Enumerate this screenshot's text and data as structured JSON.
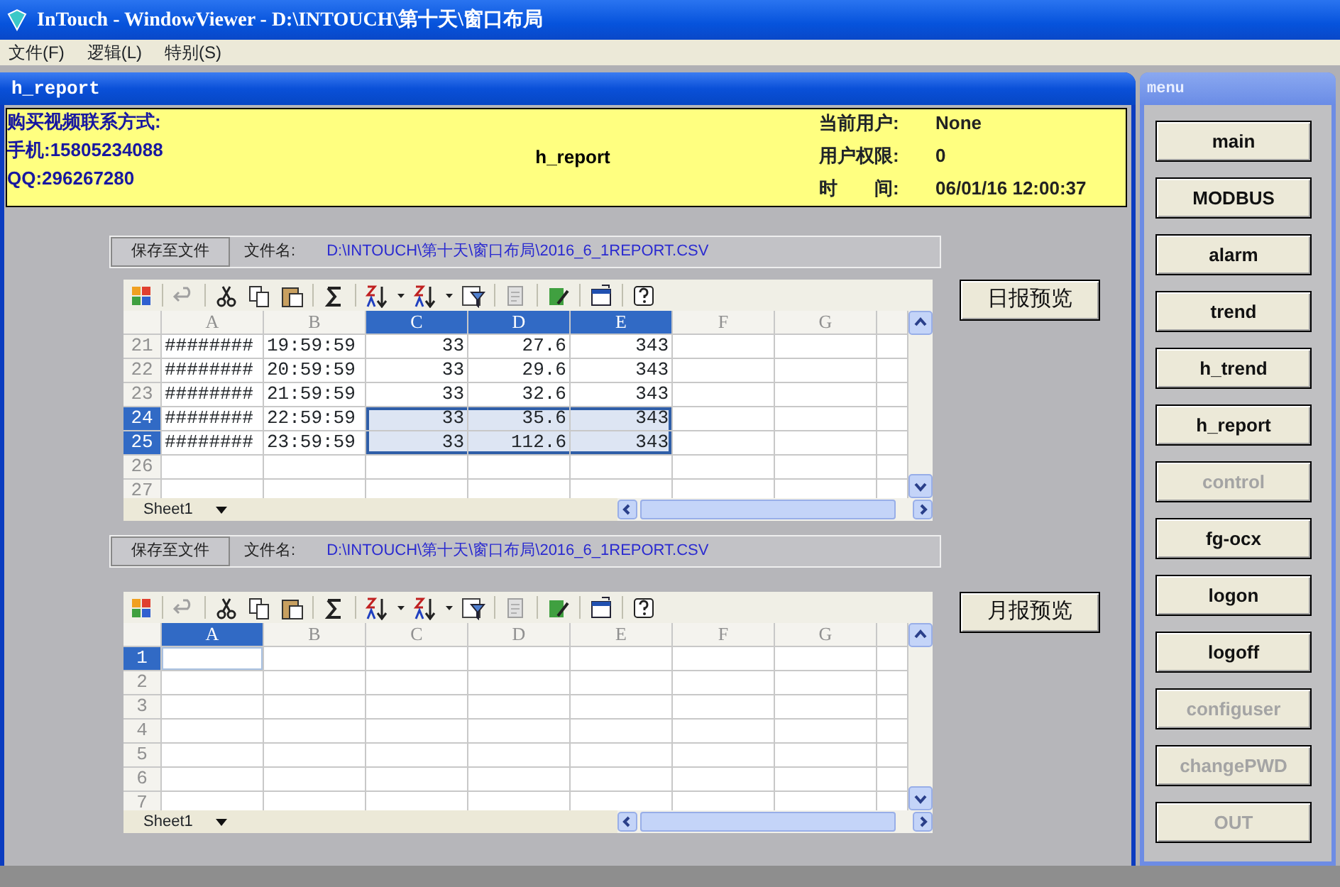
{
  "window": {
    "title": "InTouch - WindowViewer - D:\\INTOUCH\\第十天\\窗口布局"
  },
  "menu_bar": [
    "文件(F)",
    "逻辑(L)",
    "特别(S)"
  ],
  "report_window": {
    "title": "h_report",
    "contact_lines": [
      "购买视频联系方式:",
      "手机:15805234088",
      "QQ:296267280"
    ],
    "screen_name": "h_report",
    "status": [
      {
        "label": "当前用户:",
        "value": "None"
      },
      {
        "label": "用户权限:",
        "value": "0"
      },
      {
        "label": "时　　间:",
        "value": "06/01/16 12:00:37"
      }
    ],
    "reports": [
      {
        "save_button": "保存至文件",
        "file_label": "文件名:",
        "file_path": "D:\\INTOUCH\\第十天\\窗口布局\\2016_6_1REPORT.CSV",
        "columns": [
          {
            "label": "A",
            "selected": false
          },
          {
            "label": "B",
            "selected": false
          },
          {
            "label": "C",
            "selected": true
          },
          {
            "label": "D",
            "selected": true
          },
          {
            "label": "E",
            "selected": true
          },
          {
            "label": "F",
            "selected": false
          },
          {
            "label": "G",
            "selected": false
          }
        ],
        "rows": [
          {
            "number": "21",
            "selected": false,
            "cells": [
              "########",
              "19:59:59",
              "33",
              "27.6",
              "343"
            ]
          },
          {
            "number": "22",
            "selected": false,
            "cells": [
              "########",
              "20:59:59",
              "33",
              "29.6",
              "343"
            ]
          },
          {
            "number": "23",
            "selected": false,
            "cells": [
              "########",
              "21:59:59",
              "33",
              "32.6",
              "343"
            ]
          },
          {
            "number": "24",
            "selected": true,
            "cells": [
              "########",
              "22:59:59",
              "33",
              "35.6",
              "343"
            ]
          },
          {
            "number": "25",
            "selected": true,
            "cells": [
              "########",
              "23:59:59",
              "33",
              "112.6",
              "343"
            ]
          },
          {
            "number": "26",
            "selected": false
          },
          {
            "number": "27",
            "selected": false
          }
        ],
        "sheet_tab": "Sheet1",
        "preview_button": "日报预览"
      },
      {
        "save_button": "保存至文件",
        "file_label": "文件名:",
        "file_path": "D:\\INTOUCH\\第十天\\窗口布局\\2016_6_1REPORT.CSV",
        "columns": [
          {
            "label": "A",
            "selected": true
          },
          {
            "label": "B",
            "selected": false
          },
          {
            "label": "C",
            "selected": false
          },
          {
            "label": "D",
            "selected": false
          },
          {
            "label": "E",
            "selected": false
          },
          {
            "label": "F",
            "selected": false
          },
          {
            "label": "G",
            "selected": false
          }
        ],
        "rows": [
          {
            "number": "1",
            "selected": true
          },
          {
            "number": "2",
            "selected": false
          },
          {
            "number": "3",
            "selected": false
          },
          {
            "number": "4",
            "selected": false
          },
          {
            "number": "5",
            "selected": false
          },
          {
            "number": "6",
            "selected": false
          },
          {
            "number": "7",
            "selected": false
          }
        ],
        "sheet_tab": "Sheet1",
        "preview_button": "月报预览"
      }
    ]
  },
  "menu_window": {
    "title": "menu",
    "buttons": [
      {
        "label": "main",
        "disabled": false
      },
      {
        "label": "MODBUS",
        "disabled": false
      },
      {
        "label": "alarm",
        "disabled": false
      },
      {
        "label": "trend",
        "disabled": false
      },
      {
        "label": "h_trend",
        "disabled": false
      },
      {
        "label": "h_report",
        "disabled": false
      },
      {
        "label": "control",
        "disabled": true
      },
      {
        "label": "fg-ocx",
        "disabled": false
      },
      {
        "label": "logon",
        "disabled": false
      },
      {
        "label": "logoff",
        "disabled": false
      },
      {
        "label": "configuser",
        "disabled": true
      },
      {
        "label": "changePWD",
        "disabled": true
      },
      {
        "label": "OUT",
        "disabled": true
      }
    ]
  }
}
